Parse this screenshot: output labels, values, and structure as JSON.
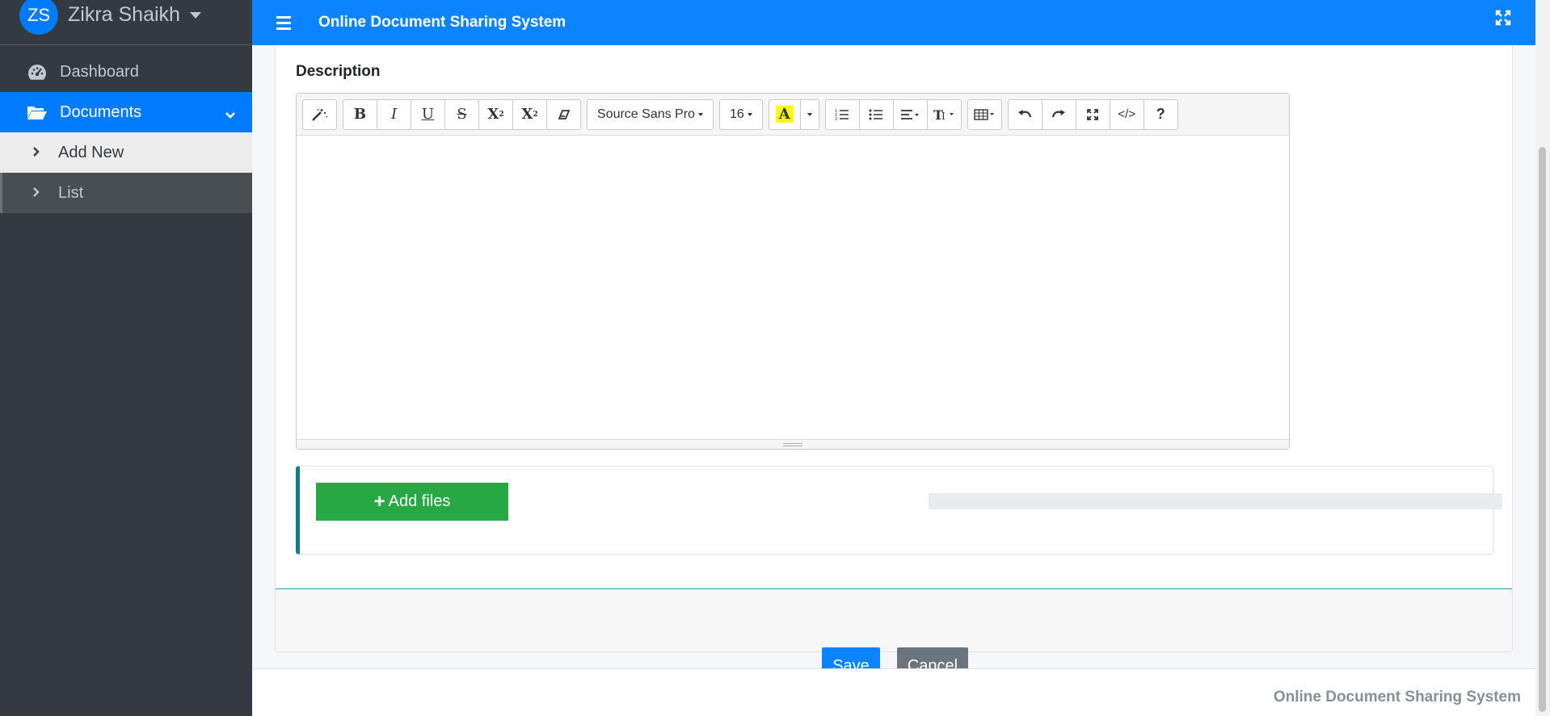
{
  "sidebar": {
    "user": {
      "initials": "ZS",
      "name": "Zikra Shaikh"
    },
    "items": [
      {
        "label": "Dashboard",
        "icon": "tachometer-icon"
      },
      {
        "label": "Documents",
        "icon": "folder-open-icon",
        "active": true,
        "children": [
          {
            "label": "Add New"
          },
          {
            "label": "List"
          }
        ]
      }
    ]
  },
  "topbar": {
    "title": "Online Document Sharing System"
  },
  "form": {
    "description_label": "Description",
    "editor": {
      "font_name": "Source Sans Pro",
      "font_size": "16",
      "buttons": [
        "magic-icon",
        "bold-icon",
        "italic-icon",
        "underline-icon",
        "strikethrough-icon",
        "superscript-icon",
        "subscript-icon",
        "eraser-icon",
        "font-family-dropdown",
        "font-size-dropdown",
        "color-icon",
        "color-dropdown",
        "ordered-list-icon",
        "unordered-list-icon",
        "align-icon",
        "line-height-icon",
        "table-icon",
        "undo-icon",
        "redo-icon",
        "fullscreen-icon",
        "code-view-icon",
        "help-icon"
      ],
      "content": ""
    },
    "upload": {
      "add_files_label": "Add files",
      "progress": 0
    },
    "save_label": "Save",
    "cancel_label": "Cancel"
  },
  "footer": {
    "text": "Online Document Sharing System"
  },
  "colors": {
    "primary": "#0d84ff",
    "sidebar": "#343a40",
    "success": "#28a745",
    "secondary": "#6c757d",
    "info_border": "#117a8b"
  }
}
